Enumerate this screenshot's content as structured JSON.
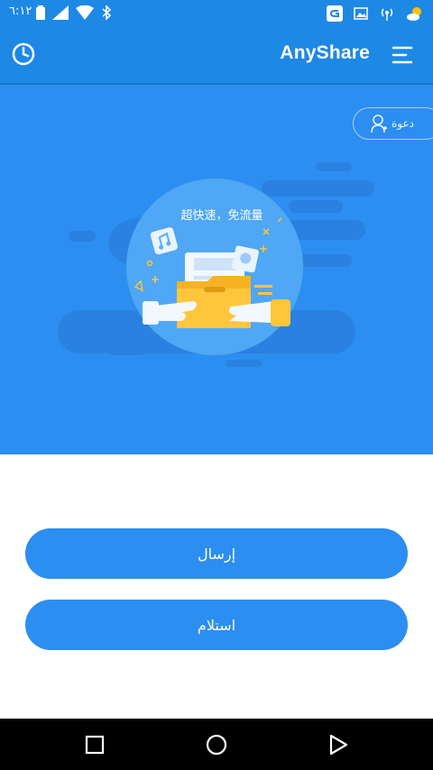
{
  "status_bar": {
    "time": "٦:١٢",
    "left_icons": [
      "battery-icon",
      "signal-icon",
      "wifi-icon",
      "bluetooth-icon"
    ],
    "right_icons": [
      "app-g-icon",
      "image-icon",
      "hotspot-icon",
      "weather-icon"
    ]
  },
  "app_bar": {
    "title": "AnyShare",
    "left_icon": "history-clock-icon",
    "right_icon": "menu-icon"
  },
  "hero": {
    "invite_label": "دعوة",
    "promo_text": "超快速，免流量"
  },
  "actions": {
    "send_label": "إرسال",
    "receive_label": "استلام"
  },
  "colors": {
    "primary": "#1e88e5",
    "hero_bg": "#2c8ef0",
    "button": "#2c8ef0",
    "nav_bar": "#000000"
  }
}
